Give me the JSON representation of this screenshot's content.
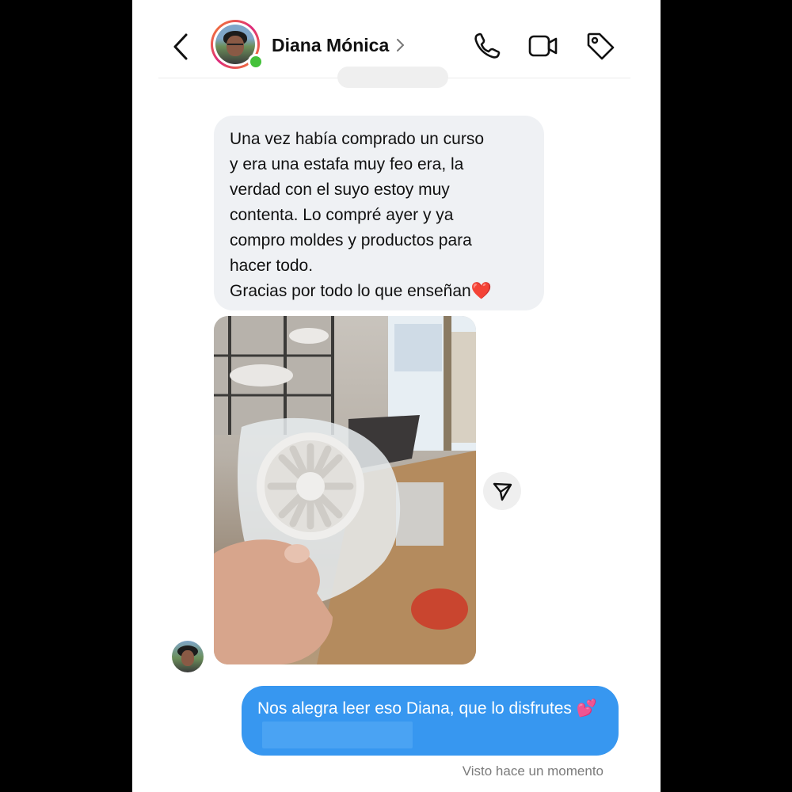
{
  "header": {
    "contact_name": "Diana Mónica",
    "icons": [
      "back-arrow-icon",
      "chevron-right-icon",
      "phone-icon",
      "video-camera-icon",
      "tag-icon"
    ],
    "online": true
  },
  "messages": {
    "incoming_text": "Una vez había comprado un curso\ny era una estafa muy feo era, la\nverdad con el suyo estoy muy\ncontenta. Lo compré ayer y ya\ncompro moldes y productos para\nhacer todo.\nGracias por todo lo que enseñan❤️",
    "outgoing_text": "Nos alegra leer eso Diana, que lo disfrutes 💕",
    "seen_status": "Visto hace un momento"
  },
  "colors": {
    "outgoing_bubble": "#3797f0",
    "incoming_bubble": "#eff1f4",
    "online_dot": "#44c13a"
  }
}
